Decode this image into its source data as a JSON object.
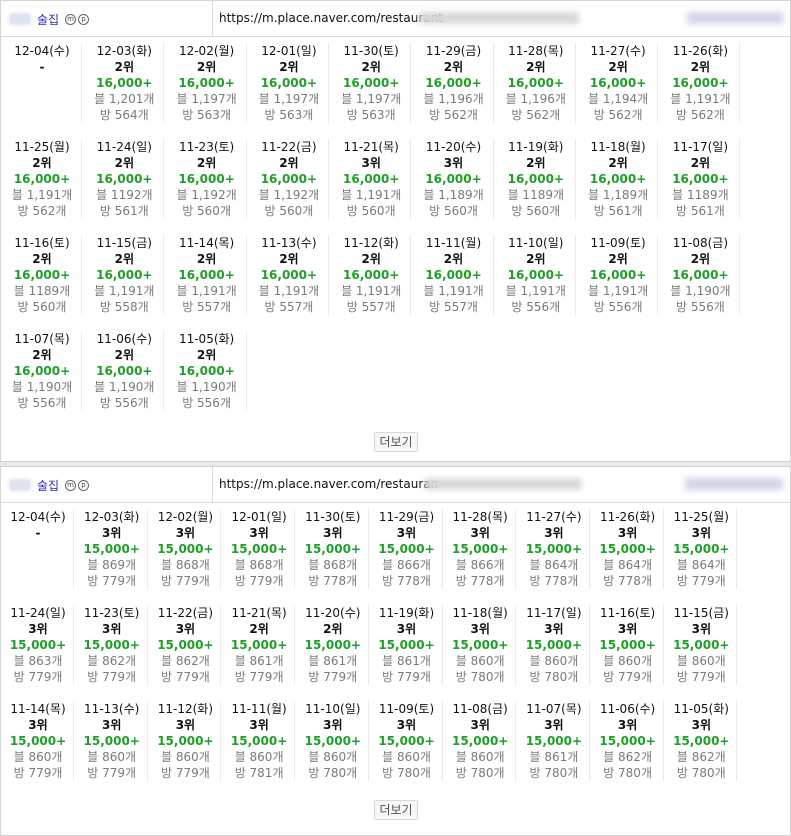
{
  "panels": [
    {
      "header": {
        "name": "술집",
        "icon1": "m",
        "icon2": "p",
        "url": "https://m.place.naver.com/restaurant"
      },
      "more_label": "더보기",
      "rows": [
        [
          {
            "date": "12-04(수)",
            "rank": "-",
            "price": "",
            "blog": "",
            "visit": ""
          },
          {
            "date": "12-03(화)",
            "rank": "2위",
            "price": "16,000+",
            "blog": "블 1,201개",
            "visit": "방 564개"
          },
          {
            "date": "12-02(월)",
            "rank": "2위",
            "price": "16,000+",
            "blog": "블 1,197개",
            "visit": "방 563개"
          },
          {
            "date": "12-01(일)",
            "rank": "2위",
            "price": "16,000+",
            "blog": "블 1,197개",
            "visit": "방 563개"
          },
          {
            "date": "11-30(토)",
            "rank": "2위",
            "price": "16,000+",
            "blog": "블 1,197개",
            "visit": "방 563개"
          },
          {
            "date": "11-29(금)",
            "rank": "2위",
            "price": "16,000+",
            "blog": "블 1,196개",
            "visit": "방 562개"
          },
          {
            "date": "11-28(목)",
            "rank": "2위",
            "price": "16,000+",
            "blog": "블 1,196개",
            "visit": "방 562개"
          },
          {
            "date": "11-27(수)",
            "rank": "2위",
            "price": "16,000+",
            "blog": "블 1,194개",
            "visit": "방 562개"
          },
          {
            "date": "11-26(화)",
            "rank": "2위",
            "price": "16,000+",
            "blog": "블 1,191개",
            "visit": "방 562개"
          }
        ],
        [
          {
            "date": "11-25(월)",
            "rank": "2위",
            "price": "16,000+",
            "blog": "블 1,191개",
            "visit": "방 562개"
          },
          {
            "date": "11-24(일)",
            "rank": "2위",
            "price": "16,000+",
            "blog": "블 1192개",
            "visit": "방 561개"
          },
          {
            "date": "11-23(토)",
            "rank": "2위",
            "price": "16,000+",
            "blog": "블 1,192개",
            "visit": "방 560개"
          },
          {
            "date": "11-22(금)",
            "rank": "2위",
            "price": "16,000+",
            "blog": "블 1,192개",
            "visit": "방 560개"
          },
          {
            "date": "11-21(목)",
            "rank": "3위",
            "price": "16,000+",
            "blog": "블 1,191개",
            "visit": "방 560개"
          },
          {
            "date": "11-20(수)",
            "rank": "3위",
            "price": "16,000+",
            "blog": "블 1,189개",
            "visit": "방 560개"
          },
          {
            "date": "11-19(화)",
            "rank": "2위",
            "price": "16,000+",
            "blog": "블 1189개",
            "visit": "방 560개"
          },
          {
            "date": "11-18(월)",
            "rank": "2위",
            "price": "16,000+",
            "blog": "블 1,189개",
            "visit": "방 561개"
          },
          {
            "date": "11-17(일)",
            "rank": "2위",
            "price": "16,000+",
            "blog": "블 1189개",
            "visit": "방 561개"
          }
        ],
        [
          {
            "date": "11-16(토)",
            "rank": "2위",
            "price": "16,000+",
            "blog": "블 1189개",
            "visit": "방 560개"
          },
          {
            "date": "11-15(금)",
            "rank": "2위",
            "price": "16,000+",
            "blog": "블 1,191개",
            "visit": "방 558개"
          },
          {
            "date": "11-14(목)",
            "rank": "2위",
            "price": "16,000+",
            "blog": "블 1,191개",
            "visit": "방 557개"
          },
          {
            "date": "11-13(수)",
            "rank": "2위",
            "price": "16,000+",
            "blog": "블 1,191개",
            "visit": "방 557개"
          },
          {
            "date": "11-12(화)",
            "rank": "2위",
            "price": "16,000+",
            "blog": "블 1,191개",
            "visit": "방 557개"
          },
          {
            "date": "11-11(월)",
            "rank": "2위",
            "price": "16,000+",
            "blog": "블 1,191개",
            "visit": "방 557개"
          },
          {
            "date": "11-10(일)",
            "rank": "2위",
            "price": "16,000+",
            "blog": "블 1,191개",
            "visit": "방 556개"
          },
          {
            "date": "11-09(토)",
            "rank": "2위",
            "price": "16,000+",
            "blog": "블 1,191개",
            "visit": "방 556개"
          },
          {
            "date": "11-08(금)",
            "rank": "2위",
            "price": "16,000+",
            "blog": "블 1,190개",
            "visit": "방 556개"
          }
        ],
        [
          {
            "date": "11-07(목)",
            "rank": "2위",
            "price": "16,000+",
            "blog": "블 1,190개",
            "visit": "방 556개"
          },
          {
            "date": "11-06(수)",
            "rank": "2위",
            "price": "16,000+",
            "blog": "블 1,190개",
            "visit": "방 556개"
          },
          {
            "date": "11-05(화)",
            "rank": "2위",
            "price": "16,000+",
            "blog": "블 1,190개",
            "visit": "방 556개"
          }
        ]
      ]
    },
    {
      "header": {
        "name": "술집",
        "icon1": "m",
        "icon2": "p",
        "url": "https://m.place.naver.com/restauran"
      },
      "more_label": "더보기",
      "rows": [
        [
          {
            "date": "12-04(수)",
            "rank": "-",
            "price": "",
            "blog": "",
            "visit": ""
          },
          {
            "date": "12-03(화)",
            "rank": "3위",
            "price": "15,000+",
            "blog": "블 869개",
            "visit": "방 779개"
          },
          {
            "date": "12-02(월)",
            "rank": "3위",
            "price": "15,000+",
            "blog": "블 868개",
            "visit": "방 779개"
          },
          {
            "date": "12-01(일)",
            "rank": "3위",
            "price": "15,000+",
            "blog": "블 868개",
            "visit": "방 779개"
          },
          {
            "date": "11-30(토)",
            "rank": "3위",
            "price": "15,000+",
            "blog": "블 868개",
            "visit": "방 778개"
          },
          {
            "date": "11-29(금)",
            "rank": "3위",
            "price": "15,000+",
            "blog": "블 866개",
            "visit": "방 778개"
          },
          {
            "date": "11-28(목)",
            "rank": "3위",
            "price": "15,000+",
            "blog": "블 866개",
            "visit": "방 778개"
          },
          {
            "date": "11-27(수)",
            "rank": "3위",
            "price": "15,000+",
            "blog": "블 864개",
            "visit": "방 778개"
          },
          {
            "date": "11-26(화)",
            "rank": "3위",
            "price": "15,000+",
            "blog": "블 864개",
            "visit": "방 778개"
          },
          {
            "date": "11-25(월)",
            "rank": "3위",
            "price": "15,000+",
            "blog": "블 864개",
            "visit": "방 779개"
          }
        ],
        [
          {
            "date": "11-24(일)",
            "rank": "3위",
            "price": "15,000+",
            "blog": "블 863개",
            "visit": "방 779개"
          },
          {
            "date": "11-23(토)",
            "rank": "3위",
            "price": "15,000+",
            "blog": "블 862개",
            "visit": "방 779개"
          },
          {
            "date": "11-22(금)",
            "rank": "3위",
            "price": "15,000+",
            "blog": "블 862개",
            "visit": "방 779개"
          },
          {
            "date": "11-21(목)",
            "rank": "2위",
            "price": "15,000+",
            "blog": "블 861개",
            "visit": "방 779개"
          },
          {
            "date": "11-20(수)",
            "rank": "2위",
            "price": "15,000+",
            "blog": "블 861개",
            "visit": "방 779개"
          },
          {
            "date": "11-19(화)",
            "rank": "3위",
            "price": "15,000+",
            "blog": "블 861개",
            "visit": "방 779개"
          },
          {
            "date": "11-18(월)",
            "rank": "3위",
            "price": "15,000+",
            "blog": "블 860개",
            "visit": "방 780개"
          },
          {
            "date": "11-17(일)",
            "rank": "3위",
            "price": "15,000+",
            "blog": "블 860개",
            "visit": "방 780개"
          },
          {
            "date": "11-16(토)",
            "rank": "3위",
            "price": "15,000+",
            "blog": "블 860개",
            "visit": "방 779개"
          },
          {
            "date": "11-15(금)",
            "rank": "3위",
            "price": "15,000+",
            "blog": "블 860개",
            "visit": "방 779개"
          }
        ],
        [
          {
            "date": "11-14(목)",
            "rank": "3위",
            "price": "15,000+",
            "blog": "블 860개",
            "visit": "방 779개"
          },
          {
            "date": "11-13(수)",
            "rank": "3위",
            "price": "15,000+",
            "blog": "블 860개",
            "visit": "방 779개"
          },
          {
            "date": "11-12(화)",
            "rank": "3위",
            "price": "15,000+",
            "blog": "블 860개",
            "visit": "방 779개"
          },
          {
            "date": "11-11(월)",
            "rank": "3위",
            "price": "15,000+",
            "blog": "블 860개",
            "visit": "방 781개"
          },
          {
            "date": "11-10(일)",
            "rank": "3위",
            "price": "15,000+",
            "blog": "블 860개",
            "visit": "방 780개"
          },
          {
            "date": "11-09(토)",
            "rank": "3위",
            "price": "15,000+",
            "blog": "블 860개",
            "visit": "방 780개"
          },
          {
            "date": "11-08(금)",
            "rank": "3위",
            "price": "15,000+",
            "blog": "블 860개",
            "visit": "방 780개"
          },
          {
            "date": "11-07(목)",
            "rank": "3위",
            "price": "15,000+",
            "blog": "블 861개",
            "visit": "방 780개"
          },
          {
            "date": "11-06(수)",
            "rank": "3위",
            "price": "15,000+",
            "blog": "블 862개",
            "visit": "방 780개"
          },
          {
            "date": "11-05(화)",
            "rank": "3위",
            "price": "15,000+",
            "blog": "블 862개",
            "visit": "방 780개"
          }
        ]
      ]
    }
  ]
}
